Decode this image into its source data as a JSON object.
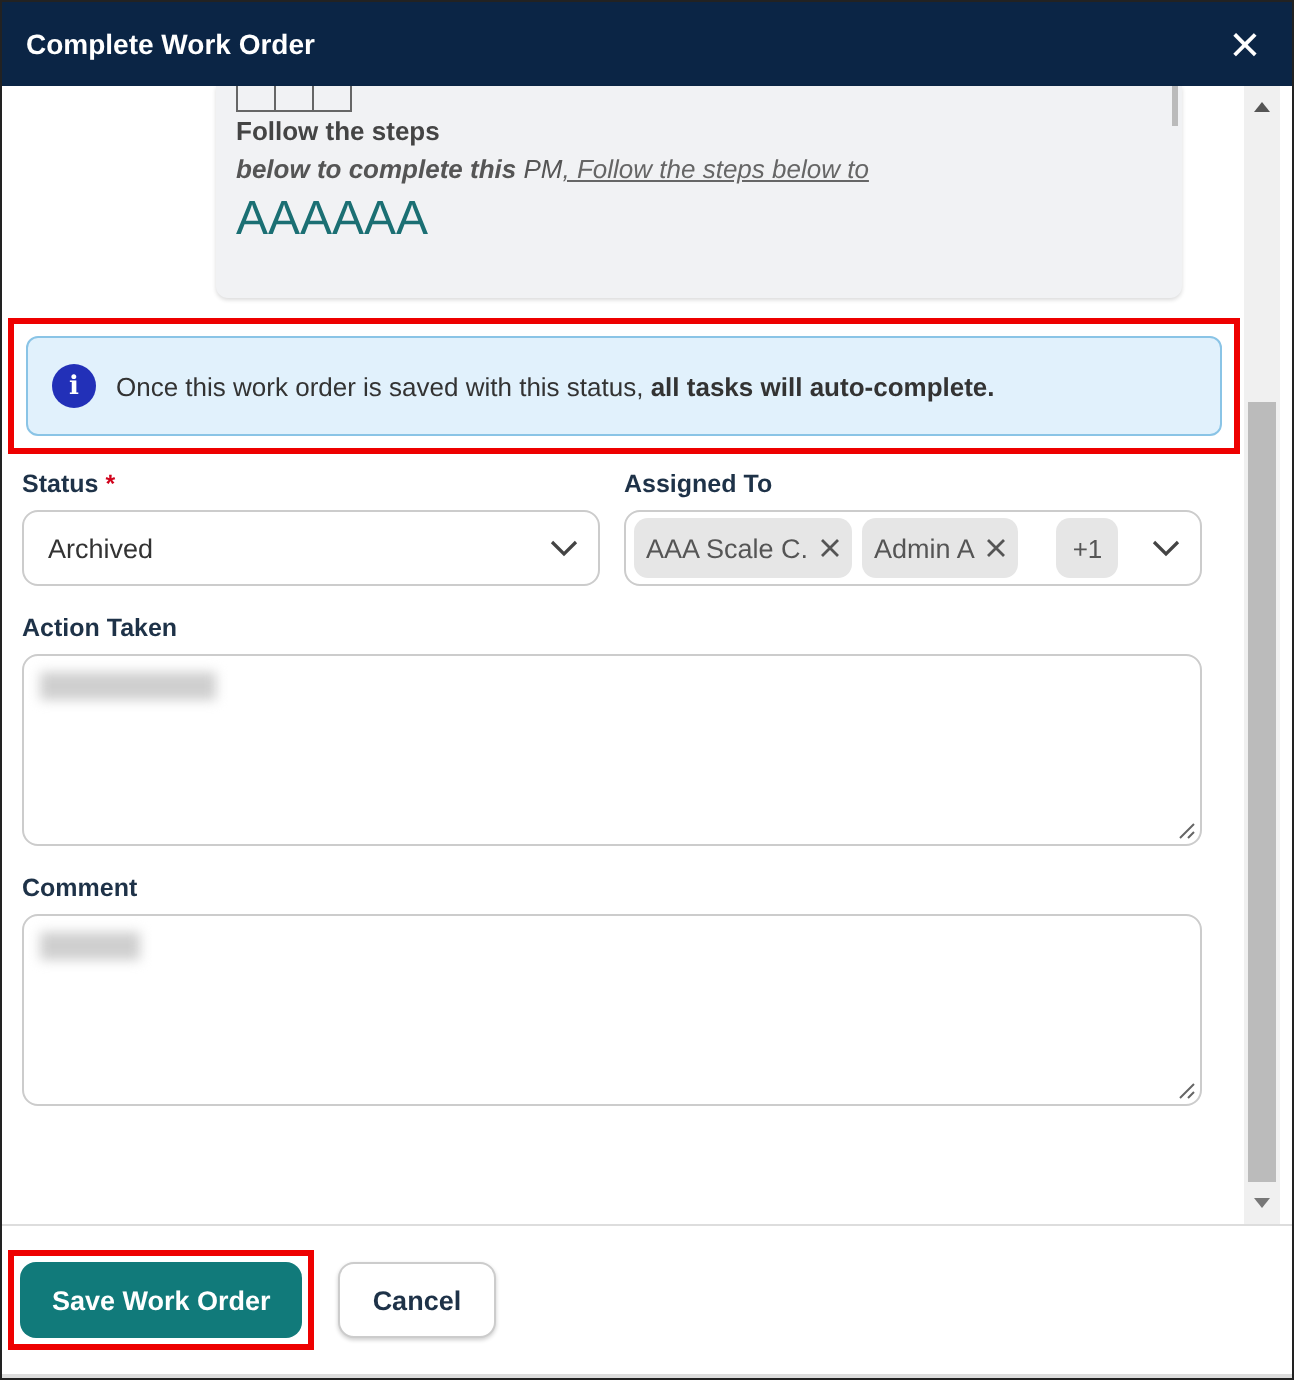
{
  "window": {
    "title": "Complete Work Order",
    "close": "×"
  },
  "preview": {
    "heading": "Follow the steps",
    "line": "**below to complete this** PM",
    "link": ", Follow the steps below to",
    "title": "AAAAAA"
  },
  "banner": {
    "icon": "i",
    "text": "Once this work order is saved with this status, **all tasks will auto-complete.**"
  },
  "status": {
    "label": "Status",
    "required": true,
    "mark": "*",
    "value": "Archived"
  },
  "assigned": {
    "label": "Assigned To",
    "chips": [
      {
        "label": "AAA Scale C."
      },
      {
        "label": "Admin A"
      }
    ],
    "more": "+1"
  },
  "fields": [
    {
      "label": "Action Taken",
      "redacted": true
    },
    {
      "label": "Comment",
      "redacted": true
    }
  ],
  "buttons": [
    {
      "label": "Save Work Order",
      "kind": "primary",
      "highlighted": true
    },
    {
      "label": "Cancel",
      "kind": "secondary",
      "highlighted": false
    }
  ]
}
